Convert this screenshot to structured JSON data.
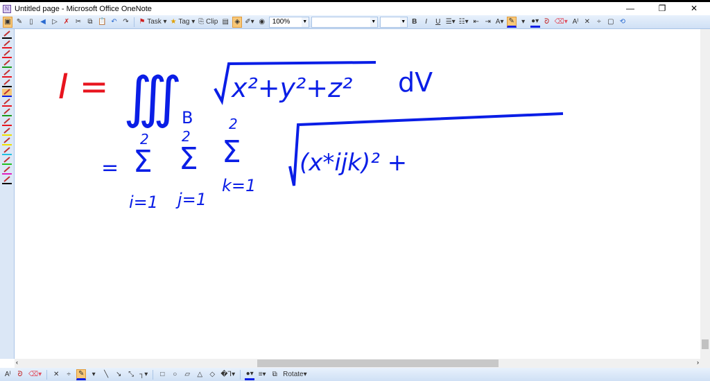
{
  "window": {
    "title": "Untitled page - Microsoft Office OneNote",
    "minimize": "—",
    "maximize": "❐",
    "close": "✕"
  },
  "toolbar": {
    "task": "Task",
    "tag": "Tag",
    "clip": "Clip",
    "zoom": "100%",
    "font": "",
    "size": ""
  },
  "bottom_toolbar": {
    "rotate": "Rotate"
  },
  "ink": {
    "lhs": "I =",
    "integrals": "∭",
    "region": "B",
    "radicand": "x²+y²+z²",
    "dv": "dV",
    "eq": "=",
    "sigma": "Σ",
    "upper": "2",
    "i_lower": "i=1",
    "j_lower": "j=1",
    "k_lower": "k=1",
    "term": "(x*ijk)² +"
  },
  "colors": {
    "accent": "#f8c878",
    "ink_blue": "#0a1ee6",
    "ink_red": "#e8141e"
  }
}
